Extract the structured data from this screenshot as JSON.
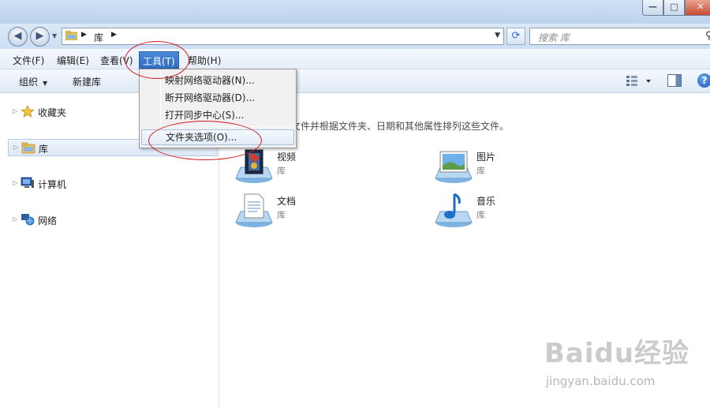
{
  "window": {
    "controls": {
      "minimize": "▭",
      "maximize": "□",
      "close": "✕"
    }
  },
  "address": {
    "crumb": "库",
    "search_placeholder": "搜索 库"
  },
  "menubar": {
    "file": "文件(F)",
    "edit": "编辑(E)",
    "view": "查看(V)",
    "tools": "工具(T)",
    "help": "帮助(H)"
  },
  "toolbar": {
    "organize": "组织",
    "new_library": "新建库"
  },
  "nav_pane": {
    "favorites": "收藏夹",
    "libraries": "库",
    "computer": "计算机",
    "network": "网络"
  },
  "tools_menu": {
    "items": [
      "映射网络驱动器(N)...",
      "断开网络驱动器(D)...",
      "打开同步中心(S)...",
      "文件夹选项(O)..."
    ]
  },
  "content": {
    "description": "文件并根据文件夹、日期和其他属性排列这些文件。",
    "libraries": [
      {
        "name": "视频",
        "sub": "库",
        "icon": "video-library-icon"
      },
      {
        "name": "图片",
        "sub": "库",
        "icon": "pictures-library-icon"
      },
      {
        "name": "文档",
        "sub": "库",
        "icon": "documents-library-icon"
      },
      {
        "name": "音乐",
        "sub": "库",
        "icon": "music-library-icon"
      }
    ]
  },
  "watermark": {
    "logo": "Baidu经验",
    "url": "jingyan.baidu.com"
  },
  "colors": {
    "menu_highlight": "#2e6dc2",
    "annotation_red": "#d21d1d",
    "selection_border": "#a8c1e3"
  }
}
